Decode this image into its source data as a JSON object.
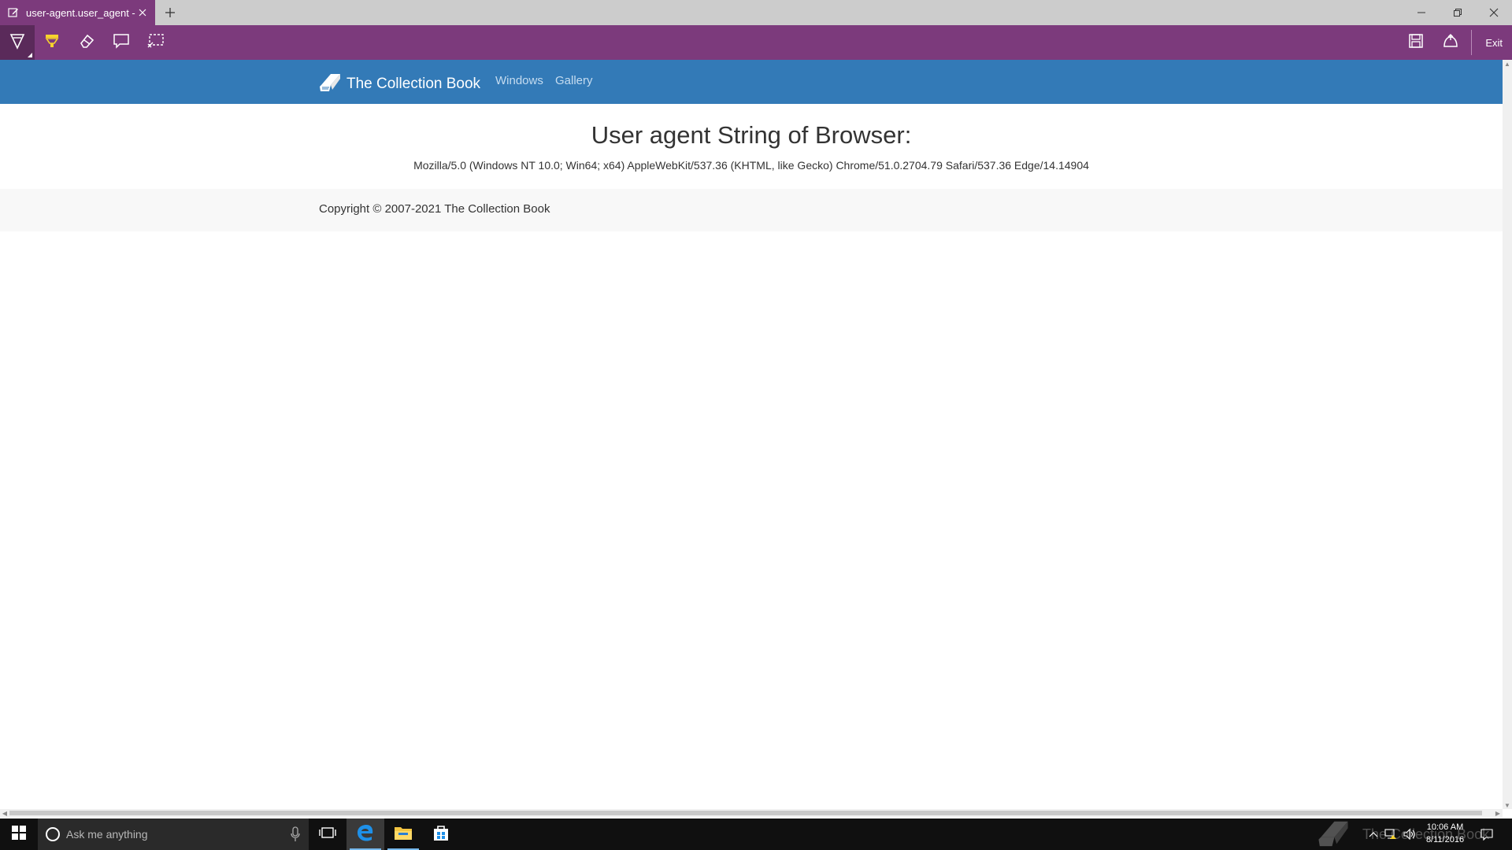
{
  "browser": {
    "tab_title": "user-agent.user_agent - ",
    "exit_label": "Exit"
  },
  "site": {
    "brand": "The Collection Book",
    "nav": [
      "Windows",
      "Gallery"
    ],
    "heading": "User agent String of Browser:",
    "user_agent": "Mozilla/5.0 (Windows NT 10.0; Win64; x64) AppleWebKit/537.36 (KHTML, like Gecko) Chrome/51.0.2704.79 Safari/537.36 Edge/14.14904",
    "copyright": "Copyright © 2007-2021 The Collection Book"
  },
  "taskbar": {
    "search_placeholder": "Ask me anything",
    "time": "10:06 AM",
    "date": "8/11/2016",
    "watermark": "The Collection Book"
  },
  "colors": {
    "accent_purple": "#7c3a7c",
    "navbar_blue": "#337ab7",
    "highlighter_yellow": "#f6d32d"
  },
  "icons": {
    "toolbar": [
      "pen-icon",
      "highlighter-icon",
      "eraser-icon",
      "comment-icon",
      "clip-icon"
    ],
    "right": [
      "save-icon",
      "share-icon"
    ]
  }
}
